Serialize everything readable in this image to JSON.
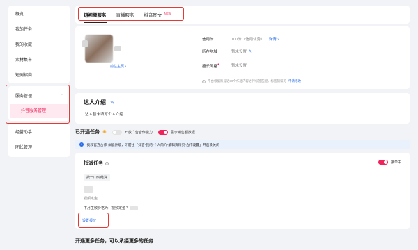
{
  "sidebar": {
    "items": [
      {
        "label": "概览"
      },
      {
        "label": "我的任务"
      },
      {
        "label": "我的收藏"
      },
      {
        "label": "素材集市"
      },
      {
        "label": "短剧招商"
      },
      {
        "label": "服务管理"
      },
      {
        "label": "抖音服务管理"
      },
      {
        "label": "经营助手"
      },
      {
        "label": "团长管理"
      }
    ]
  },
  "tabs": [
    {
      "label": "短视频服务",
      "active": true
    },
    {
      "label": "直播服务"
    },
    {
      "label": "抖音图文",
      "badge": "NEW"
    }
  ],
  "profile": {
    "homepage_link": "前往主页 ›",
    "credit_label": "信用分",
    "credit_value": "100分（信用优秀）",
    "credit_link": "详情 ›",
    "region_label": "所在地域",
    "region_value": "暂未设置",
    "style_label": "擅长风格",
    "style_value": "暂未设置",
    "tip_text": "平台根据账号近30个作品内容进行标签匹配，标签错误可",
    "tip_link": "申请修改"
  },
  "intro": {
    "title": "达人介绍",
    "text": "达人暂未填写个人介绍"
  },
  "services": {
    "title": "已开通任务",
    "toggle1_label": "开放广告合作能力",
    "toggle2_label": "展示销售额数据",
    "notice": "“找我官方合作”体能升级，可前往「抖音-我的-个人简介-编辑资料页-合作设置」开启或关闭",
    "task": {
      "title": "指派任务",
      "help": "?",
      "status": "接单中",
      "tag": "按一口价结算",
      "price_label": "视频定金",
      "next_label": "下月生效价格为：视频定金 ¥",
      "set_price": "设置报价"
    }
  },
  "more_title": "开通更多任务，可以承接更多的任务"
}
